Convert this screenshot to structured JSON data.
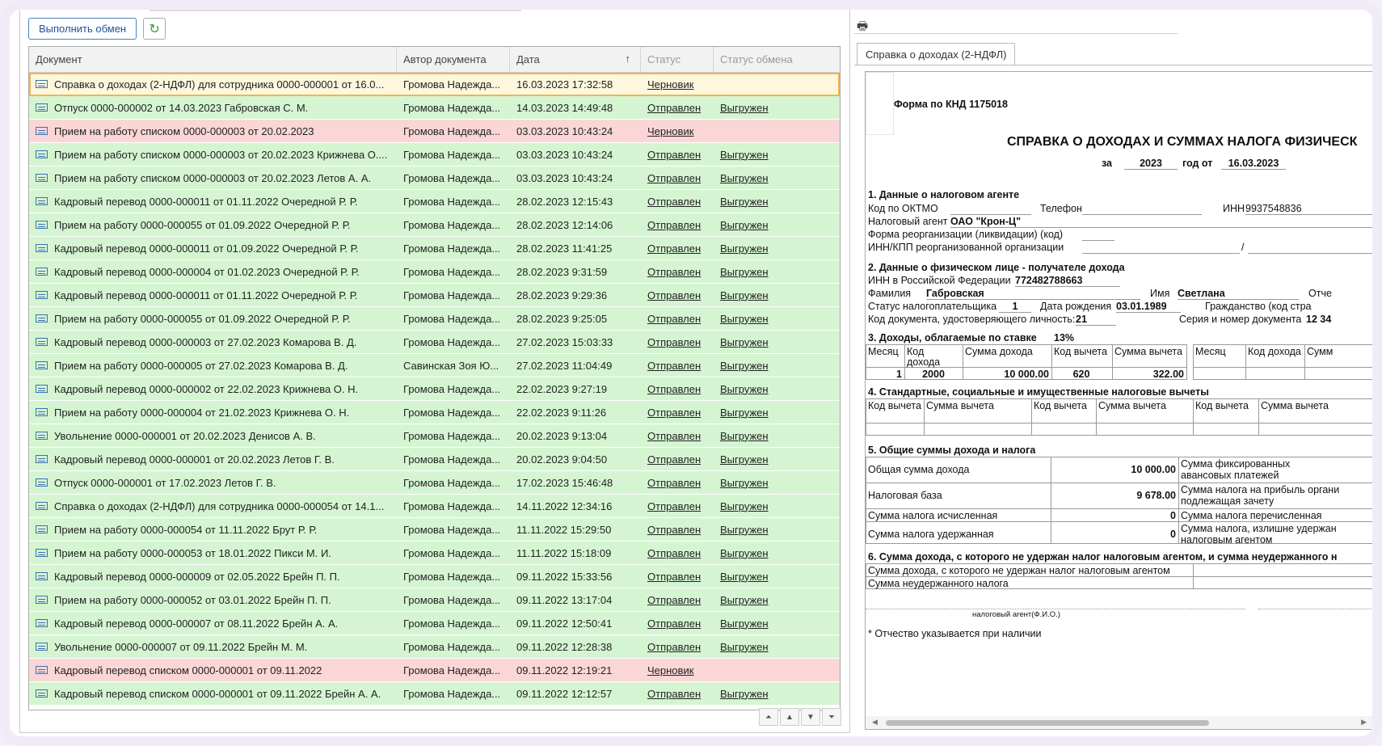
{
  "toolbar": {
    "exchange_label": "Выполнить обмен",
    "refresh_icon": "refresh-icon"
  },
  "grid": {
    "columns": [
      "Документ",
      "Автор документа",
      "Дата",
      "Статус",
      "Статус обмена"
    ],
    "sort_icon": "↑",
    "rows": [
      {
        "doc": "Справка о доходах (2-НДФЛ) для сотрудника 0000-000001 от 16.0...",
        "author": "Громова Надежда...",
        "date": "16.03.2023 17:32:58",
        "status": "Черновик",
        "exchange": "",
        "type": "sel"
      },
      {
        "doc": "Отпуск 0000-000002 от 14.03.2023 Габровская С. М.",
        "author": "Громова Надежда...",
        "date": "14.03.2023 14:49:48",
        "status": "Отправлен",
        "exchange": "Выгружен",
        "type": "green"
      },
      {
        "doc": "Прием на работу списком 0000-000003 от 20.02.2023",
        "author": "Громова Надежда...",
        "date": "03.03.2023 10:43:24",
        "status": "Черновик",
        "exchange": "",
        "type": "red"
      },
      {
        "doc": "Прием на работу списком 0000-000003 от 20.02.2023 Крижнева О....",
        "author": "Громова Надежда...",
        "date": "03.03.2023 10:43:24",
        "status": "Отправлен",
        "exchange": "Выгружен",
        "type": "green"
      },
      {
        "doc": "Прием на работу списком 0000-000003 от 20.02.2023 Летов А. А.",
        "author": "Громова Надежда...",
        "date": "03.03.2023 10:43:24",
        "status": "Отправлен",
        "exchange": "Выгружен",
        "type": "green"
      },
      {
        "doc": "Кадровый перевод 0000-000011 от 01.11.2022 Очередной Р. Р.",
        "author": "Громова Надежда...",
        "date": "28.02.2023 12:15:43",
        "status": "Отправлен",
        "exchange": "Выгружен",
        "type": "green"
      },
      {
        "doc": "Прием на работу 0000-000055 от 01.09.2022 Очередной Р. Р.",
        "author": "Громова Надежда...",
        "date": "28.02.2023 12:14:06",
        "status": "Отправлен",
        "exchange": "Выгружен",
        "type": "green"
      },
      {
        "doc": "Кадровый перевод 0000-000011 от 01.09.2022 Очередной Р. Р.",
        "author": "Громова Надежда...",
        "date": "28.02.2023 11:41:25",
        "status": "Отправлен",
        "exchange": "Выгружен",
        "type": "green"
      },
      {
        "doc": "Кадровый перевод 0000-000004 от 01.02.2023 Очередной Р. Р.",
        "author": "Громова Надежда...",
        "date": "28.02.2023 9:31:59",
        "status": "Отправлен",
        "exchange": "Выгружен",
        "type": "green"
      },
      {
        "doc": "Кадровый перевод 0000-000011 от 01.11.2022 Очередной Р. Р.",
        "author": "Громова Надежда...",
        "date": "28.02.2023 9:29:36",
        "status": "Отправлен",
        "exchange": "Выгружен",
        "type": "green"
      },
      {
        "doc": "Прием на работу 0000-000055 от 01.09.2022 Очередной Р. Р.",
        "author": "Громова Надежда...",
        "date": "28.02.2023 9:25:05",
        "status": "Отправлен",
        "exchange": "Выгружен",
        "type": "green"
      },
      {
        "doc": "Кадровый перевод 0000-000003 от 27.02.2023 Комарова В. Д.",
        "author": "Громова Надежда...",
        "date": "27.02.2023 15:03:33",
        "status": "Отправлен",
        "exchange": "Выгружен",
        "type": "green"
      },
      {
        "doc": "Прием на работу 0000-000005 от 27.02.2023 Комарова В. Д.",
        "author": "Савинская Зоя Ю...",
        "date": "27.02.2023 11:04:49",
        "status": "Отправлен",
        "exchange": "Выгружен",
        "type": "green"
      },
      {
        "doc": "Кадровый перевод 0000-000002 от 22.02.2023 Крижнева О. Н.",
        "author": "Громова Надежда...",
        "date": "22.02.2023 9:27:19",
        "status": "Отправлен",
        "exchange": "Выгружен",
        "type": "green"
      },
      {
        "doc": "Прием на работу 0000-000004 от 21.02.2023 Крижнева О. Н.",
        "author": "Громова Надежда...",
        "date": "22.02.2023 9:11:26",
        "status": "Отправлен",
        "exchange": "Выгружен",
        "type": "green"
      },
      {
        "doc": "Увольнение 0000-000001 от 20.02.2023 Денисов А. В.",
        "author": "Громова Надежда...",
        "date": "20.02.2023 9:13:04",
        "status": "Отправлен",
        "exchange": "Выгружен",
        "type": "green"
      },
      {
        "doc": "Кадровый перевод 0000-000001 от 20.02.2023 Летов Г. В.",
        "author": "Громова Надежда...",
        "date": "20.02.2023 9:04:50",
        "status": "Отправлен",
        "exchange": "Выгружен",
        "type": "green"
      },
      {
        "doc": "Отпуск 0000-000001 от 17.02.2023 Летов Г. В.",
        "author": "Громова Надежда...",
        "date": "17.02.2023 15:46:48",
        "status": "Отправлен",
        "exchange": "Выгружен",
        "type": "green"
      },
      {
        "doc": "Справка о доходах (2-НДФЛ) для сотрудника 0000-000054 от 14.1...",
        "author": "Громова Надежда...",
        "date": "14.11.2022 12:34:16",
        "status": "Отправлен",
        "exchange": "Выгружен",
        "type": "green"
      },
      {
        "doc": "Прием на работу 0000-000054 от 11.11.2022 Брут Р. Р.",
        "author": "Громова Надежда...",
        "date": "11.11.2022 15:29:50",
        "status": "Отправлен",
        "exchange": "Выгружен",
        "type": "green"
      },
      {
        "doc": "Прием на работу 0000-000053 от 18.01.2022 Пикси М. И.",
        "author": "Громова Надежда...",
        "date": "11.11.2022 15:18:09",
        "status": "Отправлен",
        "exchange": "Выгружен",
        "type": "green"
      },
      {
        "doc": "Кадровый перевод 0000-000009 от 02.05.2022 Брейн П. П.",
        "author": "Громова Надежда...",
        "date": "09.11.2022 15:33:56",
        "status": "Отправлен",
        "exchange": "Выгружен",
        "type": "green"
      },
      {
        "doc": "Прием на работу 0000-000052 от 03.01.2022 Брейн П. П.",
        "author": "Громова Надежда...",
        "date": "09.11.2022 13:17:04",
        "status": "Отправлен",
        "exchange": "Выгружен",
        "type": "green"
      },
      {
        "doc": "Кадровый перевод 0000-000007 от 08.11.2022 Брейн А. А.",
        "author": "Громова Надежда...",
        "date": "09.11.2022 12:50:41",
        "status": "Отправлен",
        "exchange": "Выгружен",
        "type": "green"
      },
      {
        "doc": "Увольнение 0000-000007 от 09.11.2022 Брейн М. М.",
        "author": "Громова Надежда...",
        "date": "09.11.2022 12:28:38",
        "status": "Отправлен",
        "exchange": "Выгружен",
        "type": "green"
      },
      {
        "doc": "Кадровый перевод списком 0000-000001 от 09.11.2022",
        "author": "Громова Надежда...",
        "date": "09.11.2022 12:19:21",
        "status": "Черновик",
        "exchange": "",
        "type": "red"
      },
      {
        "doc": "Кадровый перевод списком 0000-000001 от 09.11.2022 Брейн А. А.",
        "author": "Громова Надежда...",
        "date": "09.11.2022 12:12:57",
        "status": "Отправлен",
        "exchange": "Выгружен",
        "type": "green"
      }
    ]
  },
  "right": {
    "tab_label": "Справка о доходах (2-НДФЛ)",
    "form": {
      "knd": "Форма по КНД 1175018",
      "title": "СПРАВКА О ДОХОДАХ И СУММАХ НАЛОГА ФИЗИЧЕСК",
      "year_prefix": "за",
      "year": "2023",
      "year_mid": "год от",
      "date": "16.03.2023",
      "s1_title": "1. Данные о налоговом агенте",
      "oktmo_label": "Код по ОКТМО",
      "phone_label": "Телефон",
      "inn_label": "ИНН",
      "inn_value": "9937548836",
      "agent_label": "Налоговый агент",
      "agent_value": "ОАО \"Крон-Ц\"",
      "reorg_label": "Форма реорганизации (ликвидации)  (код)",
      "reorg_inn_label": "ИНН/КПП  реорганизованной организации",
      "slash": "/",
      "s2_title": "2. Данные о физическом лице - получателе дохода",
      "inn_rf_label": "ИНН в Российской Федерации",
      "inn_rf_value": "772482788663",
      "surname_label": "Фамилия",
      "surname_value": "Габровская",
      "name_label": "Имя",
      "name_value": "Светлана",
      "patronymic_label": "Отче",
      "status_label": "Статус налогоплательщика",
      "status_value": "1",
      "birth_label": "Дата рождения",
      "birth_value": "03.01.1989",
      "citizen_label": "Гражданство (код стра",
      "doccode_label": "Код документа, удостоверяющего личность:",
      "doccode_value": "21",
      "series_label": "Серия и номер документа",
      "series_value": "12 34",
      "s3_title": "3. Доходы, облагаемые по ставке",
      "s3_rate": "13%",
      "s3_h_month": "Месяц",
      "s3_h_code1": "Код",
      "s3_h_code2": "дохода",
      "s3_h_sum": "Сумма дохода",
      "s3_h_dcode": "Код вычета",
      "s3_h_dsum": "Сумма вычета",
      "s3_h_month2": "Месяц",
      "s3_h_code_b": "Код дохода",
      "s3_h_sum_b": "Сумм",
      "s3_r_month": "1",
      "s3_r_code": "2000",
      "s3_r_sum": "10 000.00",
      "s3_r_dcode": "620",
      "s3_r_dsum": "322.00",
      "s4_title": "4. Стандартные, социальные и имущественные налоговые вычеты",
      "s4_h1": "Код вычета",
      "s4_h2": "Сумма вычета",
      "s4_h3": "Код вычета",
      "s4_h4": "Сумма вычета",
      "s4_h5": "Код вычета",
      "s4_h6": "Сумма вычета",
      "s5_title": "5. Общие суммы дохода и налога",
      "s5_total_label": "Общая сумма дохода",
      "s5_total_value": "10 000.00",
      "s5_fixed_label1": "Сумма фиксированных",
      "s5_fixed_label2": "авансовых платежей",
      "s5_base_label": "Налоговая база",
      "s5_base_value": "9 678.00",
      "s5_profit_label1": "Сумма налога на прибыль органи",
      "s5_profit_label2": "подлежащая зачету",
      "s5_calc_label": "Сумма налога исчисленная",
      "s5_calc_value": "0",
      "s5_transferred_label": "Сумма налога перечисленная",
      "s5_withheld_label": "Сумма налога удержанная",
      "s5_withheld_value": "0",
      "s5_excess_label1": "Сумма налога, излишне удержан",
      "s5_excess_label2": "налоговым агентом",
      "s6_title": "6. Сумма дохода, с которого не удержан налог налоговым агентом, и сумма неудержанного н",
      "s6_row1": "Сумма дохода, с которого не удержан налог налоговым агентом",
      "s6_row2": "Сумма неудержанного налога",
      "sign_caption": "налоговый агент(Ф.И.О.)",
      "footnote": "* Отчество указывается при наличии"
    }
  }
}
